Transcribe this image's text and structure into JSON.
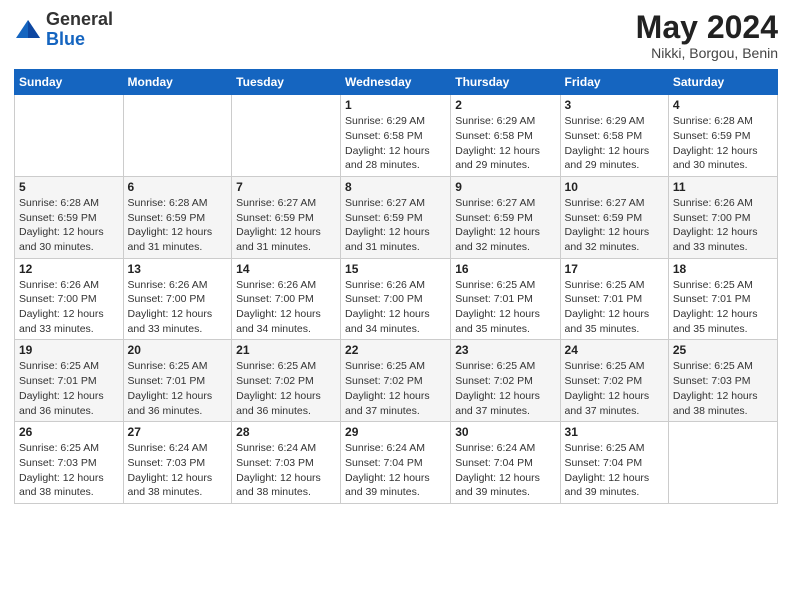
{
  "logo": {
    "general": "General",
    "blue": "Blue"
  },
  "title": "May 2024",
  "location": "Nikki, Borgou, Benin",
  "weekdays": [
    "Sunday",
    "Monday",
    "Tuesday",
    "Wednesday",
    "Thursday",
    "Friday",
    "Saturday"
  ],
  "weeks": [
    [
      {
        "day": "",
        "info": ""
      },
      {
        "day": "",
        "info": ""
      },
      {
        "day": "",
        "info": ""
      },
      {
        "day": "1",
        "info": "Sunrise: 6:29 AM\nSunset: 6:58 PM\nDaylight: 12 hours and 28 minutes."
      },
      {
        "day": "2",
        "info": "Sunrise: 6:29 AM\nSunset: 6:58 PM\nDaylight: 12 hours and 29 minutes."
      },
      {
        "day": "3",
        "info": "Sunrise: 6:29 AM\nSunset: 6:58 PM\nDaylight: 12 hours and 29 minutes."
      },
      {
        "day": "4",
        "info": "Sunrise: 6:28 AM\nSunset: 6:59 PM\nDaylight: 12 hours and 30 minutes."
      }
    ],
    [
      {
        "day": "5",
        "info": "Sunrise: 6:28 AM\nSunset: 6:59 PM\nDaylight: 12 hours and 30 minutes."
      },
      {
        "day": "6",
        "info": "Sunrise: 6:28 AM\nSunset: 6:59 PM\nDaylight: 12 hours and 31 minutes."
      },
      {
        "day": "7",
        "info": "Sunrise: 6:27 AM\nSunset: 6:59 PM\nDaylight: 12 hours and 31 minutes."
      },
      {
        "day": "8",
        "info": "Sunrise: 6:27 AM\nSunset: 6:59 PM\nDaylight: 12 hours and 31 minutes."
      },
      {
        "day": "9",
        "info": "Sunrise: 6:27 AM\nSunset: 6:59 PM\nDaylight: 12 hours and 32 minutes."
      },
      {
        "day": "10",
        "info": "Sunrise: 6:27 AM\nSunset: 6:59 PM\nDaylight: 12 hours and 32 minutes."
      },
      {
        "day": "11",
        "info": "Sunrise: 6:26 AM\nSunset: 7:00 PM\nDaylight: 12 hours and 33 minutes."
      }
    ],
    [
      {
        "day": "12",
        "info": "Sunrise: 6:26 AM\nSunset: 7:00 PM\nDaylight: 12 hours and 33 minutes."
      },
      {
        "day": "13",
        "info": "Sunrise: 6:26 AM\nSunset: 7:00 PM\nDaylight: 12 hours and 33 minutes."
      },
      {
        "day": "14",
        "info": "Sunrise: 6:26 AM\nSunset: 7:00 PM\nDaylight: 12 hours and 34 minutes."
      },
      {
        "day": "15",
        "info": "Sunrise: 6:26 AM\nSunset: 7:00 PM\nDaylight: 12 hours and 34 minutes."
      },
      {
        "day": "16",
        "info": "Sunrise: 6:25 AM\nSunset: 7:01 PM\nDaylight: 12 hours and 35 minutes."
      },
      {
        "day": "17",
        "info": "Sunrise: 6:25 AM\nSunset: 7:01 PM\nDaylight: 12 hours and 35 minutes."
      },
      {
        "day": "18",
        "info": "Sunrise: 6:25 AM\nSunset: 7:01 PM\nDaylight: 12 hours and 35 minutes."
      }
    ],
    [
      {
        "day": "19",
        "info": "Sunrise: 6:25 AM\nSunset: 7:01 PM\nDaylight: 12 hours and 36 minutes."
      },
      {
        "day": "20",
        "info": "Sunrise: 6:25 AM\nSunset: 7:01 PM\nDaylight: 12 hours and 36 minutes."
      },
      {
        "day": "21",
        "info": "Sunrise: 6:25 AM\nSunset: 7:02 PM\nDaylight: 12 hours and 36 minutes."
      },
      {
        "day": "22",
        "info": "Sunrise: 6:25 AM\nSunset: 7:02 PM\nDaylight: 12 hours and 37 minutes."
      },
      {
        "day": "23",
        "info": "Sunrise: 6:25 AM\nSunset: 7:02 PM\nDaylight: 12 hours and 37 minutes."
      },
      {
        "day": "24",
        "info": "Sunrise: 6:25 AM\nSunset: 7:02 PM\nDaylight: 12 hours and 37 minutes."
      },
      {
        "day": "25",
        "info": "Sunrise: 6:25 AM\nSunset: 7:03 PM\nDaylight: 12 hours and 38 minutes."
      }
    ],
    [
      {
        "day": "26",
        "info": "Sunrise: 6:25 AM\nSunset: 7:03 PM\nDaylight: 12 hours and 38 minutes."
      },
      {
        "day": "27",
        "info": "Sunrise: 6:24 AM\nSunset: 7:03 PM\nDaylight: 12 hours and 38 minutes."
      },
      {
        "day": "28",
        "info": "Sunrise: 6:24 AM\nSunset: 7:03 PM\nDaylight: 12 hours and 38 minutes."
      },
      {
        "day": "29",
        "info": "Sunrise: 6:24 AM\nSunset: 7:04 PM\nDaylight: 12 hours and 39 minutes."
      },
      {
        "day": "30",
        "info": "Sunrise: 6:24 AM\nSunset: 7:04 PM\nDaylight: 12 hours and 39 minutes."
      },
      {
        "day": "31",
        "info": "Sunrise: 6:25 AM\nSunset: 7:04 PM\nDaylight: 12 hours and 39 minutes."
      },
      {
        "day": "",
        "info": ""
      }
    ]
  ]
}
